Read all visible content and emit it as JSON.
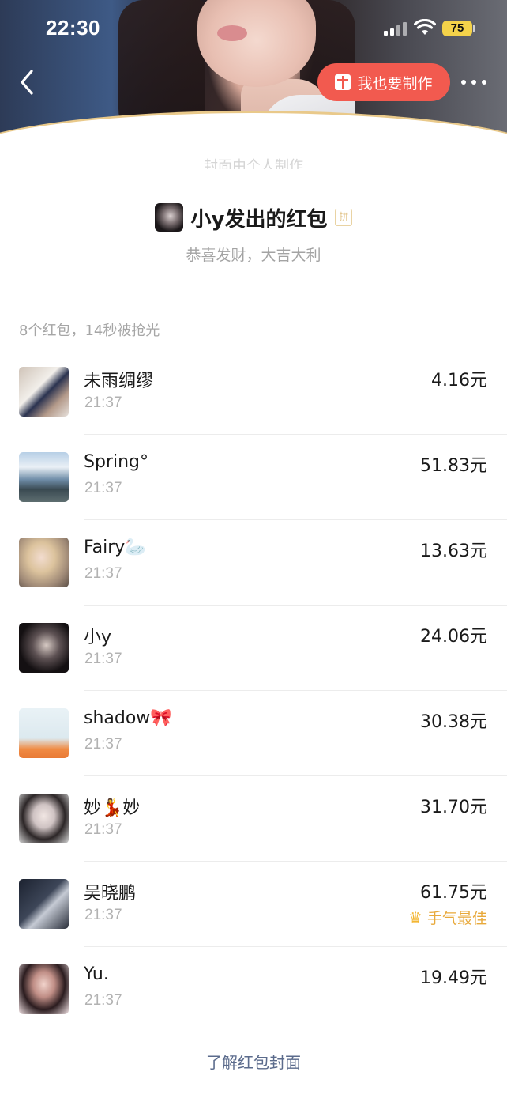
{
  "status_bar": {
    "time": "22:30",
    "battery": "75"
  },
  "header": {
    "make_button_label": "我也要制作",
    "cover_caption": "封面由个人制作"
  },
  "sender": {
    "title": "小y发出的红包",
    "pin_badge": "拼",
    "blessing": "恭喜发财，大吉大利"
  },
  "summary": "8个红包，14秒被抢光",
  "recipients": [
    {
      "name": "未雨绸缪",
      "time": "21:37",
      "amount": "4.16元",
      "best": ""
    },
    {
      "name": "Spring°",
      "time": "21:37",
      "amount": "51.83元",
      "best": ""
    },
    {
      "name": "Fairy🦢",
      "time": "21:37",
      "amount": "13.63元",
      "best": ""
    },
    {
      "name": "小y",
      "time": "21:37",
      "amount": "24.06元",
      "best": ""
    },
    {
      "name": "shadow🎀",
      "time": "21:37",
      "amount": "30.38元",
      "best": ""
    },
    {
      "name": "妙💃妙",
      "time": "21:37",
      "amount": "31.70元",
      "best": ""
    },
    {
      "name": "吴晓鹏",
      "time": "21:37",
      "amount": "61.75元",
      "best": "手气最佳"
    },
    {
      "name": "Yu.",
      "time": "21:37",
      "amount": "19.49元",
      "best": ""
    }
  ],
  "footer": {
    "link_label": "了解红包封面"
  },
  "colors": {
    "accent_red": "#f25a4f",
    "best_luck": "#e8a93b",
    "link": "#5b6b8c",
    "battery": "#f5d34a"
  },
  "icons": {
    "back": "chevron-left-icon",
    "make": "gift-icon",
    "more": "more-dots-icon",
    "best": "crown-icon"
  }
}
